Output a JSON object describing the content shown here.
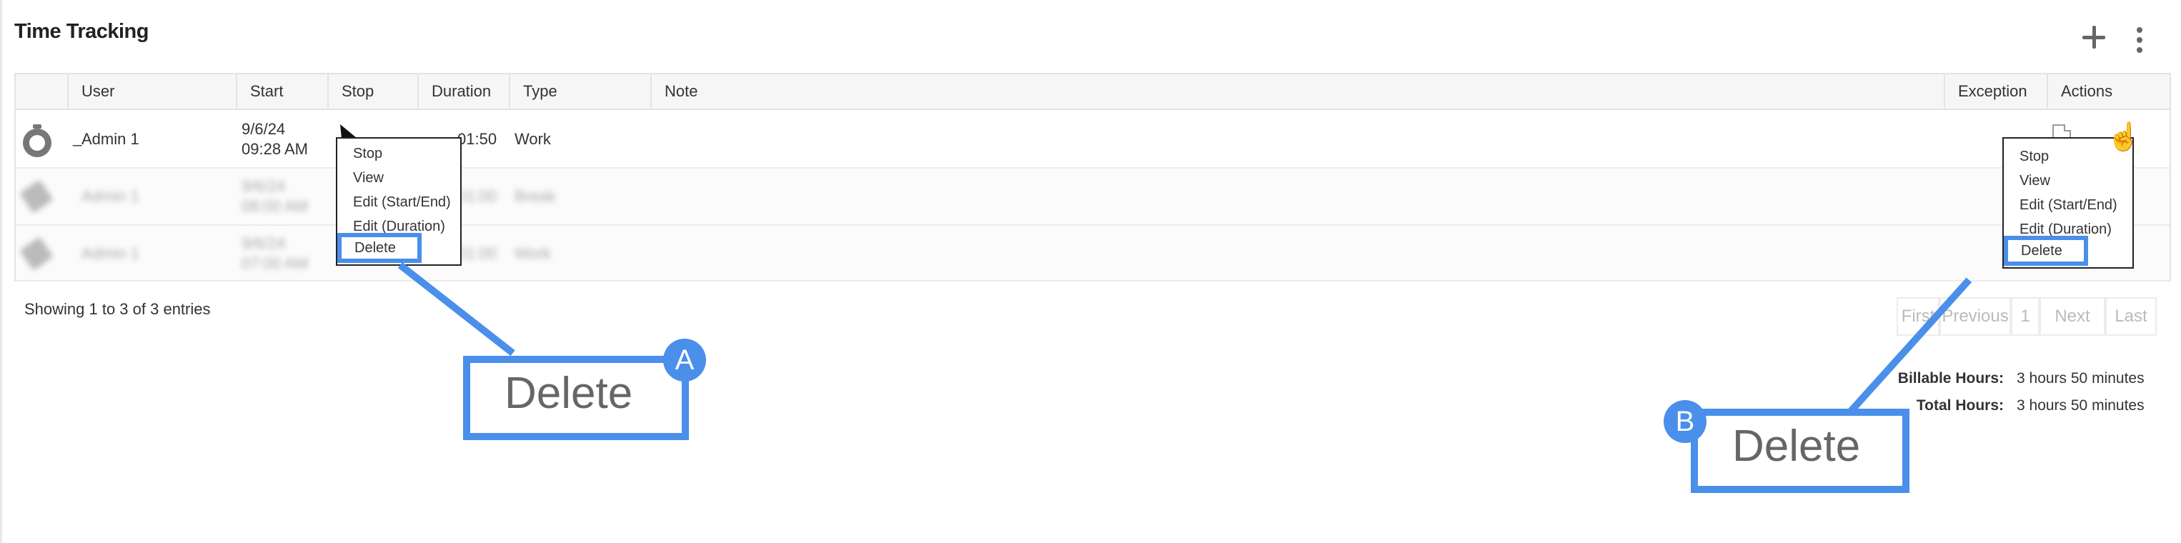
{
  "header": {
    "title": "Time Tracking"
  },
  "table": {
    "columns": [
      "User",
      "Start",
      "Stop",
      "Duration",
      "Type",
      "Note",
      "Exception",
      "Actions"
    ],
    "rows": [
      {
        "user": "Admin 1",
        "start_date": "9/6/24",
        "start_time": "09:28 AM",
        "duration": "01:50",
        "type": "Work"
      },
      {
        "user": "Admin 1",
        "start_date": "9/6/24",
        "start_time": "08:00 AM",
        "duration": "01:00",
        "type": "Break"
      },
      {
        "user": "Admin 1",
        "start_date": "9/6/24",
        "start_time": "07:00 AM",
        "duration": "01:00",
        "type": "Work"
      }
    ]
  },
  "context_menu_left": {
    "items": [
      "Stop",
      "View",
      "Edit (Start/End)",
      "Edit (Duration)",
      "Delete"
    ]
  },
  "context_menu_right": {
    "items": [
      "Stop",
      "View",
      "Edit (Start/End)",
      "Edit (Duration)",
      "Delete"
    ]
  },
  "footer": {
    "entries_info": "Showing 1 to 3 of 3 entries",
    "pagination": [
      "First",
      "Previous",
      "1",
      "Next",
      "Last"
    ]
  },
  "totals": {
    "billable_label": "Billable Hours:",
    "billable_value": "3 hours 50 minutes",
    "total_label": "Total Hours:",
    "total_value": "3 hours 50 minutes"
  },
  "callouts": [
    {
      "letter": "A",
      "text": "Delete"
    },
    {
      "letter": "B",
      "text": "Delete"
    }
  ],
  "colors": {
    "accent": "#4a8fea",
    "header_bg": "#f6f6f6",
    "border": "#e3e3e3"
  },
  "icons": [
    "plus-icon",
    "more-vertical-icon",
    "stopwatch-icon",
    "document-icon",
    "hand-pointer-cursor",
    "arrow-pointer-cursor"
  ]
}
